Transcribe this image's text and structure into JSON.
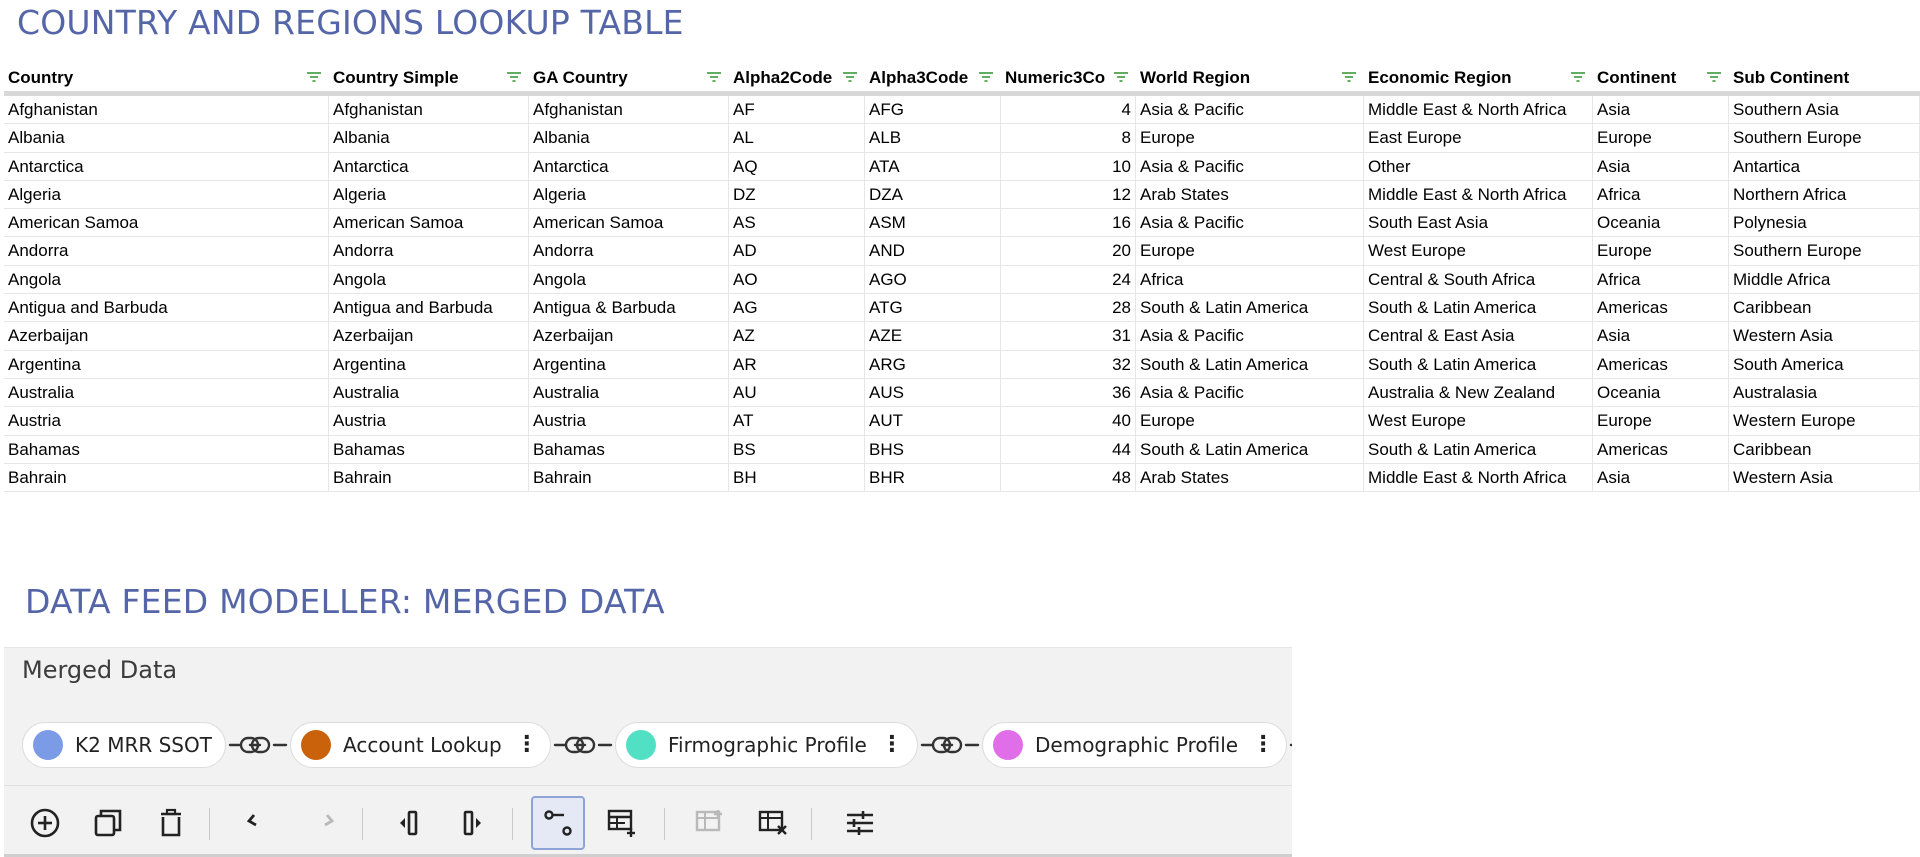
{
  "sections": {
    "lookup_title": "COUNTRY AND REGIONS LOOKUP TABLE",
    "modeller_title": "DATA FEED MODELLER: MERGED DATA"
  },
  "table": {
    "columns": [
      "Country",
      "Country Simple",
      "GA Country",
      "Alpha2Code",
      "Alpha3Code",
      "Numeric3Co",
      "World Region",
      "Economic Region",
      "Continent",
      "Sub Continent"
    ],
    "rows": [
      [
        "Afghanistan",
        "Afghanistan",
        "Afghanistan",
        "AF",
        "AFG",
        "4",
        "Asia & Pacific",
        "Middle East & North Africa",
        "Asia",
        "Southern Asia"
      ],
      [
        "Albania",
        "Albania",
        "Albania",
        "AL",
        "ALB",
        "8",
        "Europe",
        "East Europe",
        "Europe",
        "Southern Europe"
      ],
      [
        "Antarctica",
        "Antarctica",
        "Antarctica",
        "AQ",
        "ATA",
        "10",
        "Asia & Pacific",
        "Other",
        "Asia",
        "Antartica"
      ],
      [
        "Algeria",
        "Algeria",
        "Algeria",
        "DZ",
        "DZA",
        "12",
        "Arab States",
        "Middle East & North Africa",
        "Africa",
        "Northern Africa"
      ],
      [
        "American Samoa",
        "American Samoa",
        "American Samoa",
        "AS",
        "ASM",
        "16",
        "Asia & Pacific",
        "South East Asia",
        "Oceania",
        "Polynesia"
      ],
      [
        "Andorra",
        "Andorra",
        "Andorra",
        "AD",
        "AND",
        "20",
        "Europe",
        "West Europe",
        "Europe",
        "Southern Europe"
      ],
      [
        "Angola",
        "Angola",
        "Angola",
        "AO",
        "AGO",
        "24",
        "Africa",
        "Central & South Africa",
        "Africa",
        "Middle Africa"
      ],
      [
        "Antigua and Barbuda",
        "Antigua and Barbuda",
        "Antigua & Barbuda",
        "AG",
        "ATG",
        "28",
        "South & Latin America",
        "South & Latin America",
        "Americas",
        "Caribbean"
      ],
      [
        "Azerbaijan",
        "Azerbaijan",
        "Azerbaijan",
        "AZ",
        "AZE",
        "31",
        "Asia & Pacific",
        "Central & East Asia",
        "Asia",
        "Western Asia"
      ],
      [
        "Argentina",
        "Argentina",
        "Argentina",
        "AR",
        "ARG",
        "32",
        "South & Latin America",
        "South & Latin America",
        "Americas",
        "South America"
      ],
      [
        "Australia",
        "Australia",
        "Australia",
        "AU",
        "AUS",
        "36",
        "Asia & Pacific",
        "Australia & New Zealand",
        "Oceania",
        "Australasia"
      ],
      [
        "Austria",
        "Austria",
        "Austria",
        "AT",
        "AUT",
        "40",
        "Europe",
        "West Europe",
        "Europe",
        "Western Europe"
      ],
      [
        "Bahamas",
        "Bahamas",
        "Bahamas",
        "BS",
        "BHS",
        "44",
        "South & Latin America",
        "South & Latin America",
        "Americas",
        "Caribbean"
      ],
      [
        "Bahrain",
        "Bahrain",
        "Bahrain",
        "BH",
        "BHR",
        "48",
        "Arab States",
        "Middle East & North Africa",
        "Asia",
        "Western Asia"
      ]
    ]
  },
  "merged_panel": {
    "label": "Merged Data",
    "sources": [
      {
        "name": "K2 MRR SSOT",
        "color": "#7b9be6",
        "has_menu": false
      },
      {
        "name": "Account Lookup",
        "color": "#c9620a",
        "has_menu": true
      },
      {
        "name": "Firmographic Profile",
        "color": "#52e0c4",
        "has_menu": true
      },
      {
        "name": "Demographic Profile",
        "color": "#e06ee8",
        "has_menu": true
      }
    ],
    "toolbar": [
      {
        "icon": "add-circle-icon",
        "name": "add-source-button",
        "enabled": true
      },
      {
        "icon": "duplicate-icon",
        "name": "duplicate-button",
        "enabled": true
      },
      {
        "icon": "trash-icon",
        "name": "delete-button",
        "enabled": true
      },
      {
        "icon": "undo-icon",
        "name": "undo-button",
        "enabled": true
      },
      {
        "icon": "redo-icon",
        "name": "redo-button",
        "enabled": false
      },
      {
        "icon": "insert-column-left-icon",
        "name": "insert-left-button",
        "enabled": true
      },
      {
        "icon": "insert-column-right-icon",
        "name": "insert-right-button",
        "enabled": true
      },
      {
        "icon": "join-icon",
        "name": "join-button",
        "enabled": true,
        "active": true
      },
      {
        "icon": "table-add-icon",
        "name": "add-table-button",
        "enabled": true
      },
      {
        "icon": "table-add-row-icon",
        "name": "add-row-button",
        "enabled": false
      },
      {
        "icon": "table-remove-icon",
        "name": "remove-table-button",
        "enabled": true
      },
      {
        "icon": "settings-sliders-icon",
        "name": "settings-button",
        "enabled": true
      }
    ]
  }
}
